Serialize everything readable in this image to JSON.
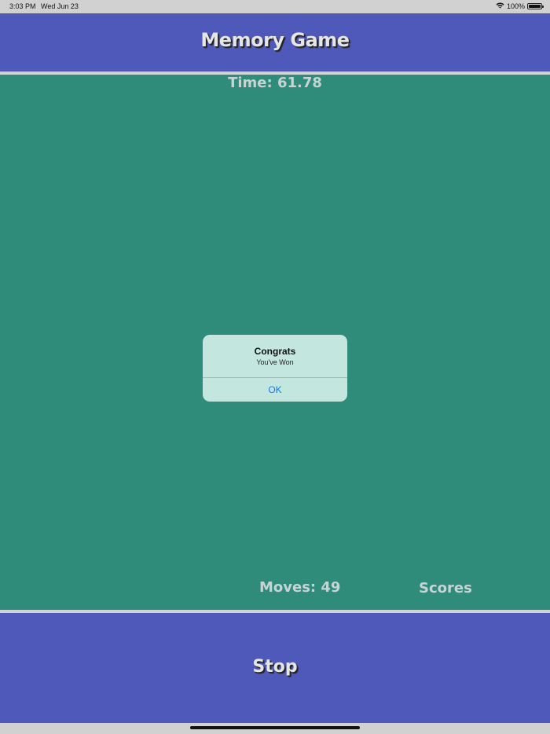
{
  "status_bar": {
    "time": "3:03 PM",
    "date": "Wed Jun 23",
    "battery": "100%",
    "wifi_icon": "wifi-icon",
    "battery_icon": "battery-icon"
  },
  "header": {
    "title": "Memory Game"
  },
  "board": {
    "timer": "Time: 61.78",
    "moves": "Moves: 49",
    "scores_label": "Scores"
  },
  "alert": {
    "title": "Congrats",
    "message": "You've Won",
    "ok_label": "OK"
  },
  "footer": {
    "stop_label": "Stop"
  },
  "colors": {
    "header_bg": "#4f59b9",
    "board_bg": "#2f8b7a",
    "alert_bg": "#c3e6df",
    "alert_button": "#1b79e0"
  }
}
